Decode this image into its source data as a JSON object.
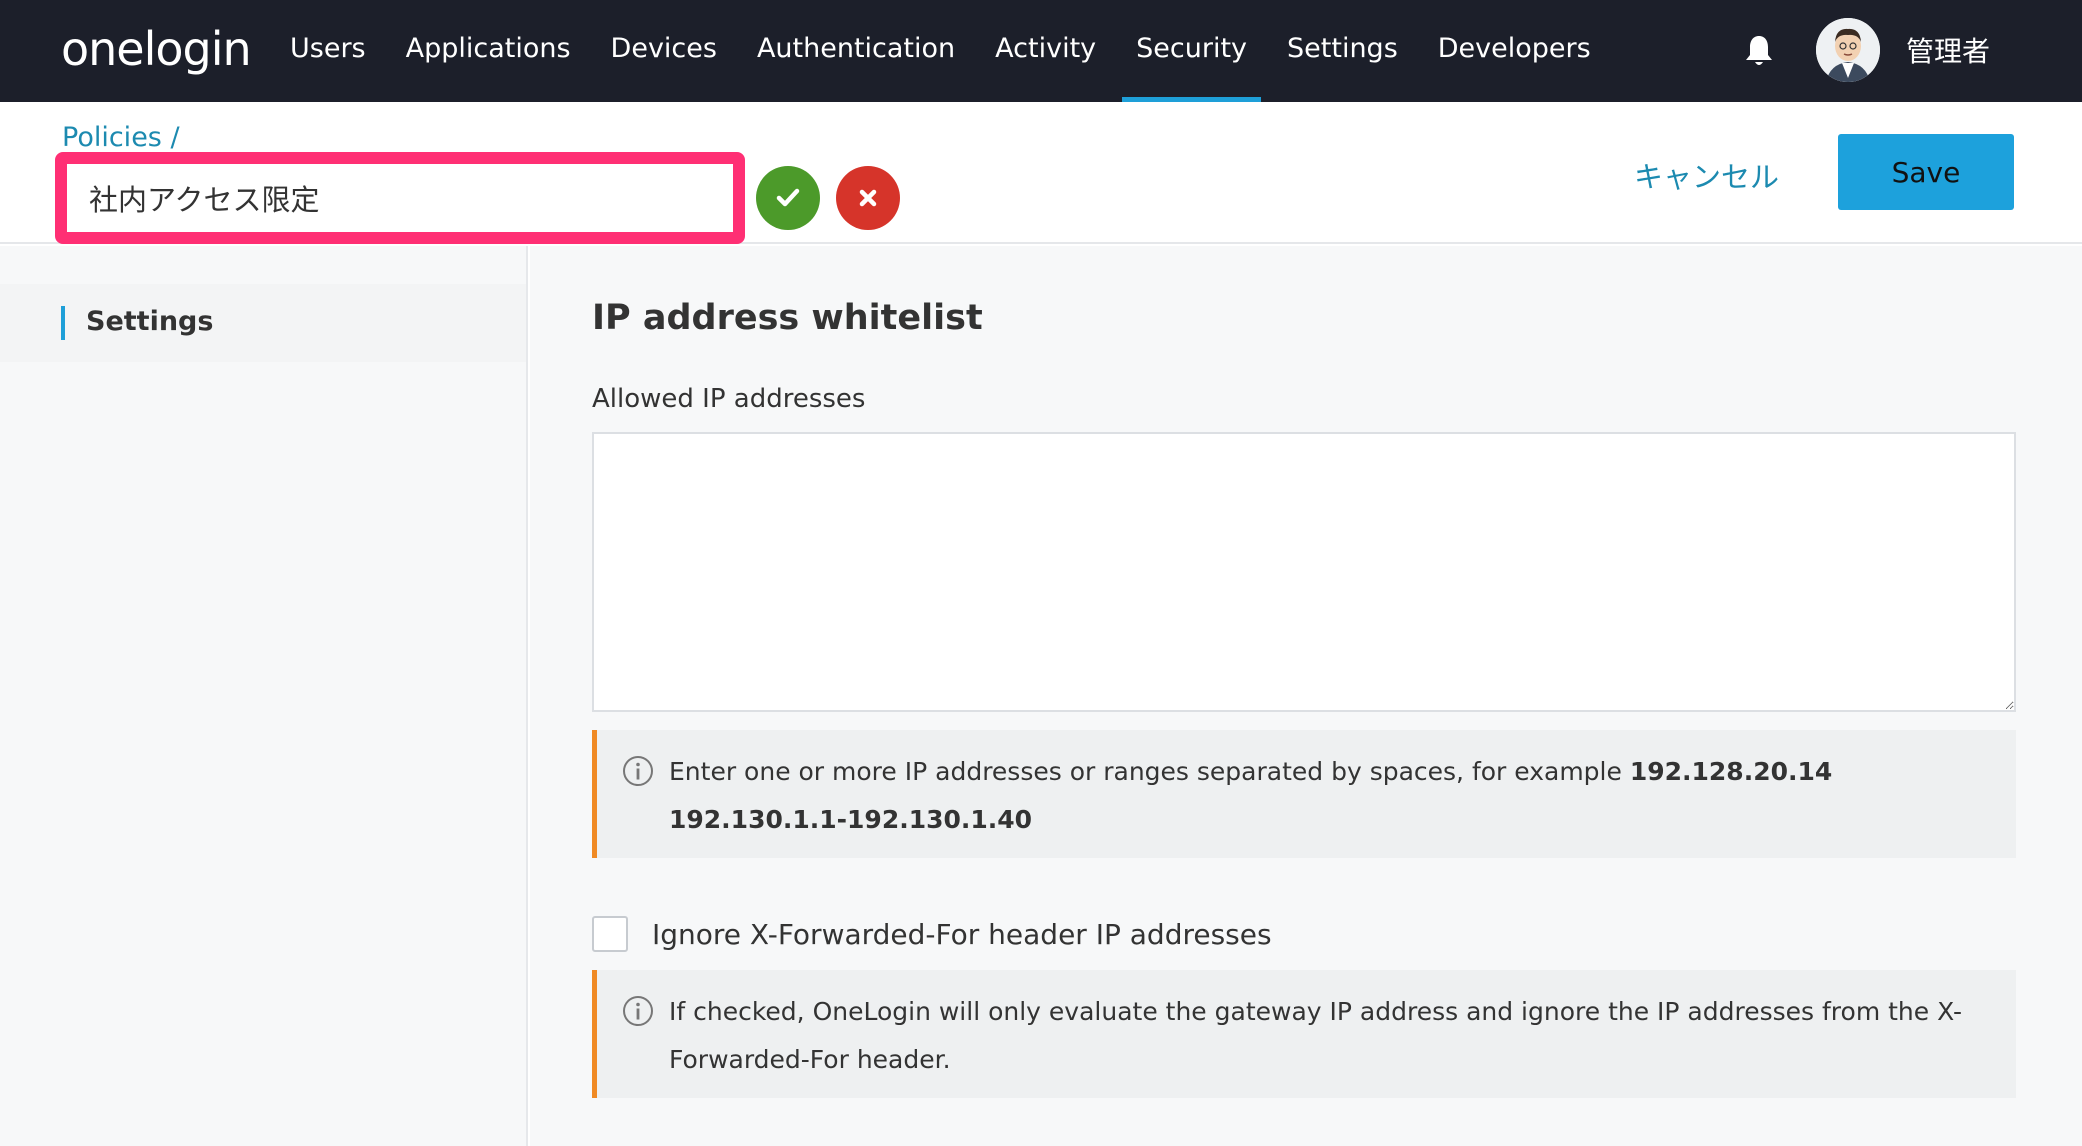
{
  "app": {
    "logo_text": "onelogin"
  },
  "nav": {
    "items": [
      {
        "label": "Users"
      },
      {
        "label": "Applications"
      },
      {
        "label": "Devices"
      },
      {
        "label": "Authentication"
      },
      {
        "label": "Activity"
      },
      {
        "label": "Security",
        "active": true
      },
      {
        "label": "Settings"
      },
      {
        "label": "Developers"
      }
    ],
    "accent_color": "#1e9fd8"
  },
  "user": {
    "name": "管理者"
  },
  "header": {
    "breadcrumb": "Policies /",
    "policy_name_value": "社内アクセス限定",
    "cancel_label": "キャンセル",
    "save_label": "Save",
    "highlight_color": "#ff2f74"
  },
  "sidebar": {
    "items": [
      {
        "label": "Settings",
        "active": true
      }
    ]
  },
  "main": {
    "section_title": "IP address whitelist",
    "field_label": "Allowed IP addresses",
    "textarea_value": "",
    "info_1": {
      "prefix": "Enter one or more IP addresses or ranges separated by spaces, for example ",
      "example": "192.128.20.14 192.130.1.1-192.130.1.40"
    },
    "checkbox_label": "Ignore X-Forwarded-For header IP addresses",
    "checkbox_checked": false,
    "info_2": "If checked, OneLogin will only evaluate the gateway IP address and ignore the IP addresses from the X-Forwarded-For header."
  }
}
